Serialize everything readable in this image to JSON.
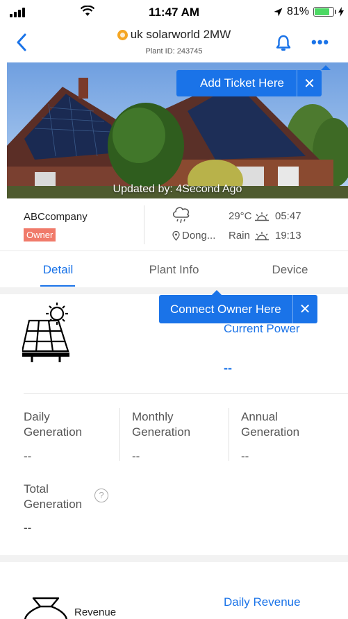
{
  "status_bar": {
    "time": "11:47 AM",
    "battery_percent": "81%",
    "battery_level": 0.81
  },
  "header": {
    "title": "uk solarworld 2MW",
    "plant_id": "Plant ID: 243745"
  },
  "hero": {
    "updated_text": "Updated by: 4Second Ago"
  },
  "tooltips": {
    "add_ticket": "Add Ticket Here",
    "connect_owner": "Connect Owner Here",
    "close_glyph": "✕"
  },
  "info": {
    "company": "ABCcompany",
    "role": "Owner",
    "location": "Dong...",
    "temperature": "29°C",
    "condition": "Rain",
    "sunrise": "05:47",
    "sunset": "19:13"
  },
  "tabs": [
    "Detail",
    "Plant Info",
    "Device"
  ],
  "power": {
    "label": "Current Power",
    "value": "--"
  },
  "generation": {
    "daily_label": "Daily\nGeneration",
    "daily_value": "--",
    "monthly_label": "Monthly\nGeneration",
    "monthly_value": "--",
    "annual_label": "Annual\nGeneration",
    "annual_value": "--",
    "total_label": "Total\nGeneration",
    "total_value": "--",
    "help_glyph": "?"
  },
  "revenue": {
    "label": "Revenue",
    "daily_label": "Daily Revenue"
  },
  "colors": {
    "accent": "#1a73e8",
    "owner_badge": "#f07a6a",
    "battery": "#4cd964",
    "plant_dot": "#f5a623"
  }
}
